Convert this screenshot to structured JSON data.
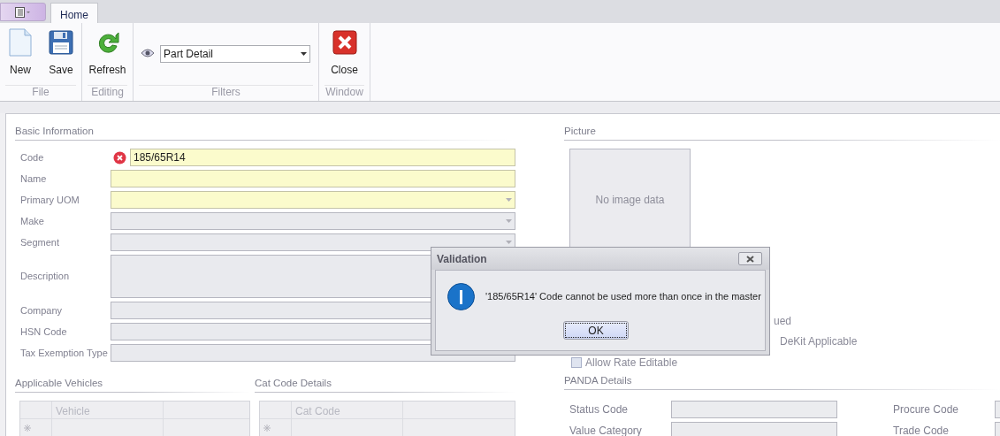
{
  "ribbon": {
    "tabs": [
      {
        "label": "Home",
        "selected": true
      }
    ],
    "groups": [
      {
        "label": "File",
        "kind": "buttons",
        "buttons": [
          {
            "label": "New",
            "kind": "new"
          },
          {
            "label": "Save",
            "kind": "save"
          }
        ]
      },
      {
        "label": "Editing",
        "kind": "buttons",
        "buttons": [
          {
            "label": "Refresh",
            "kind": "refresh"
          }
        ]
      },
      {
        "label": "Filters",
        "kind": "filter",
        "filter": {
          "value": "Part Detail"
        }
      },
      {
        "label": "Window",
        "kind": "buttons",
        "buttons": [
          {
            "label": "Close",
            "kind": "close"
          }
        ]
      }
    ]
  },
  "basic_information": {
    "title": "Basic Information",
    "fields": [
      {
        "label": "Code",
        "value": "185/65R14",
        "kind": "text",
        "required": true,
        "error": true
      },
      {
        "label": "Name",
        "kind": "text",
        "required": true,
        "error": false
      },
      {
        "label": "Primary UOM",
        "kind": "dropdown",
        "required": true,
        "error": false
      },
      {
        "label": "Make",
        "kind": "dropdown",
        "required": false,
        "error": false
      },
      {
        "label": "Segment",
        "kind": "dropdown",
        "required": false,
        "error": false
      },
      {
        "label": "Description",
        "kind": "memo",
        "required": false,
        "error": false
      },
      {
        "label": "Company",
        "kind": "text",
        "required": false,
        "error": false
      },
      {
        "label": "HSN Code",
        "kind": "text",
        "required": false,
        "error": false
      },
      {
        "label": "Tax Exemption Type",
        "kind": "text",
        "required": false,
        "error": false
      }
    ]
  },
  "picture": {
    "title": "Picture",
    "empty_text": "No image data"
  },
  "options": [
    {
      "label": "ued"
    },
    {
      "label": "DeKit Applicable"
    },
    {
      "label": "Allow Rate Editable",
      "checked": false
    }
  ],
  "applicable_vehicles": {
    "title": "Applicable Vehicles",
    "columns": [
      "Vehicle"
    ]
  },
  "cat_code_details": {
    "title": "Cat Code Details",
    "columns": [
      "Cat Code"
    ]
  },
  "panda_details": {
    "title": "PANDA Details",
    "fields": [
      {
        "label": "Status Code"
      },
      {
        "label": "Procure Code"
      },
      {
        "label": "Value Category"
      },
      {
        "label": "Trade Code"
      }
    ]
  },
  "dialog": {
    "title": "Validation",
    "message": "'185/65R14' Code cannot be used more than once in the master",
    "buttons": [
      {
        "label": "OK",
        "focused": true
      }
    ]
  }
}
